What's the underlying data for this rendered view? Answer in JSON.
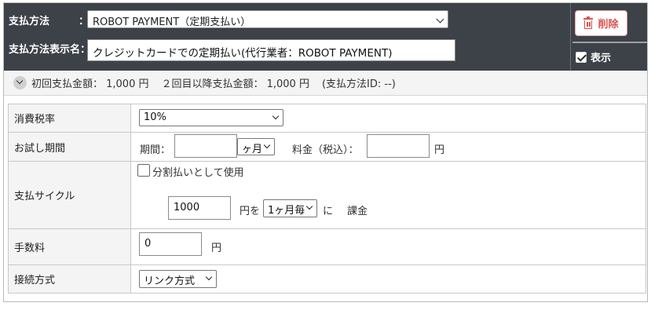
{
  "header": {
    "payment_method_label": "支払方法",
    "colon": "：",
    "payment_method_value": "ROBOT PAYMENT（定期支払い）",
    "display_name_label": "支払方法表示名：",
    "display_name_value": "クレジットカードでの定期払い(代行業者：ROBOT PAYMENT)",
    "delete_label": "削除",
    "show_label": "表示",
    "show_checked": true
  },
  "summary": {
    "first_amount": "初回支払金額： 1,000 円",
    "second_amount": "２回目以降支払金額： 1,000 円",
    "payment_id": "(支払方法ID: --)"
  },
  "form": {
    "tax_rate": {
      "label": "消費税率",
      "value": "10%"
    },
    "trial": {
      "label": "お試し期間",
      "period_label": "期間：",
      "period_value": "",
      "period_unit": "ヶ月",
      "fee_label": "料金（税込）：",
      "fee_value": "",
      "fee_unit": "円"
    },
    "cycle": {
      "label": "支払サイクル",
      "installment_label": "分割払いとして使用",
      "installment_checked": false,
      "amount_value": "1000",
      "amount_unit": "円を",
      "interval": "1ヶ月毎",
      "ni": "に",
      "charge": "課金"
    },
    "fee": {
      "label": "手数料",
      "value": "0",
      "unit": "円"
    },
    "connection": {
      "label": "接続方式",
      "value": "リンク方式"
    }
  },
  "colors": {
    "header_bg": "#3d4148",
    "delete_red": "#d9534f",
    "label_bg": "#f4f4f4"
  }
}
